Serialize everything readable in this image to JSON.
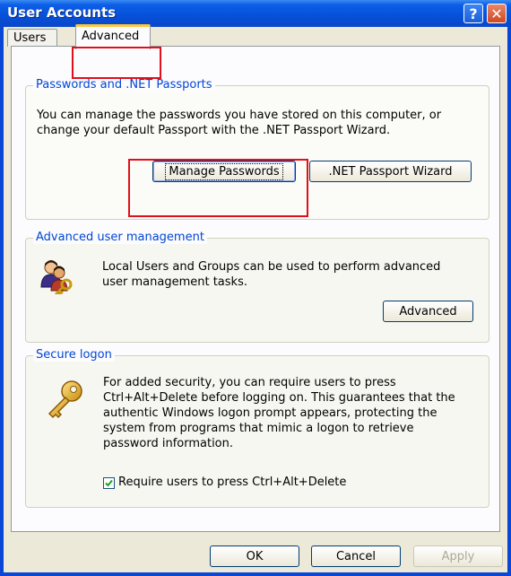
{
  "window": {
    "title": "User Accounts",
    "help_glyph": "?",
    "close_glyph": "✕"
  },
  "tabs": [
    {
      "label": "Users"
    },
    {
      "label": "Advanced"
    }
  ],
  "passwords_group": {
    "title": "Passwords and .NET Passports",
    "description_line1": "You can manage the passwords you have stored on this computer, or",
    "description_line2": "change your default Passport with the .NET Passport Wizard.",
    "manage_button": "Manage Passwords",
    "wizard_button": ".NET Passport Wizard"
  },
  "user_mgmt_group": {
    "title": "Advanced user management",
    "description_line1": "Local Users and Groups can be used to perform advanced",
    "description_line2": "user management tasks.",
    "advanced_button": "Advanced",
    "icon": "users-key-icon"
  },
  "secure_logon_group": {
    "title": "Secure logon",
    "lines": [
      "For added security, you can require users to press",
      "Ctrl+Alt+Delete before logging on. This guarantees that the",
      "authentic Windows logon prompt appears, protecting the",
      "system from programs that mimic a logon to retrieve",
      "password information."
    ],
    "checkbox_label": "Require users to press Ctrl+Alt+Delete",
    "checkbox_checked": true,
    "icon": "key-icon"
  },
  "footer": {
    "ok": "OK",
    "cancel": "Cancel",
    "apply": "Apply"
  },
  "colors": {
    "title_bar": "#0a47d6",
    "group_title": "#0046d5",
    "highlight": "#e0101a"
  }
}
